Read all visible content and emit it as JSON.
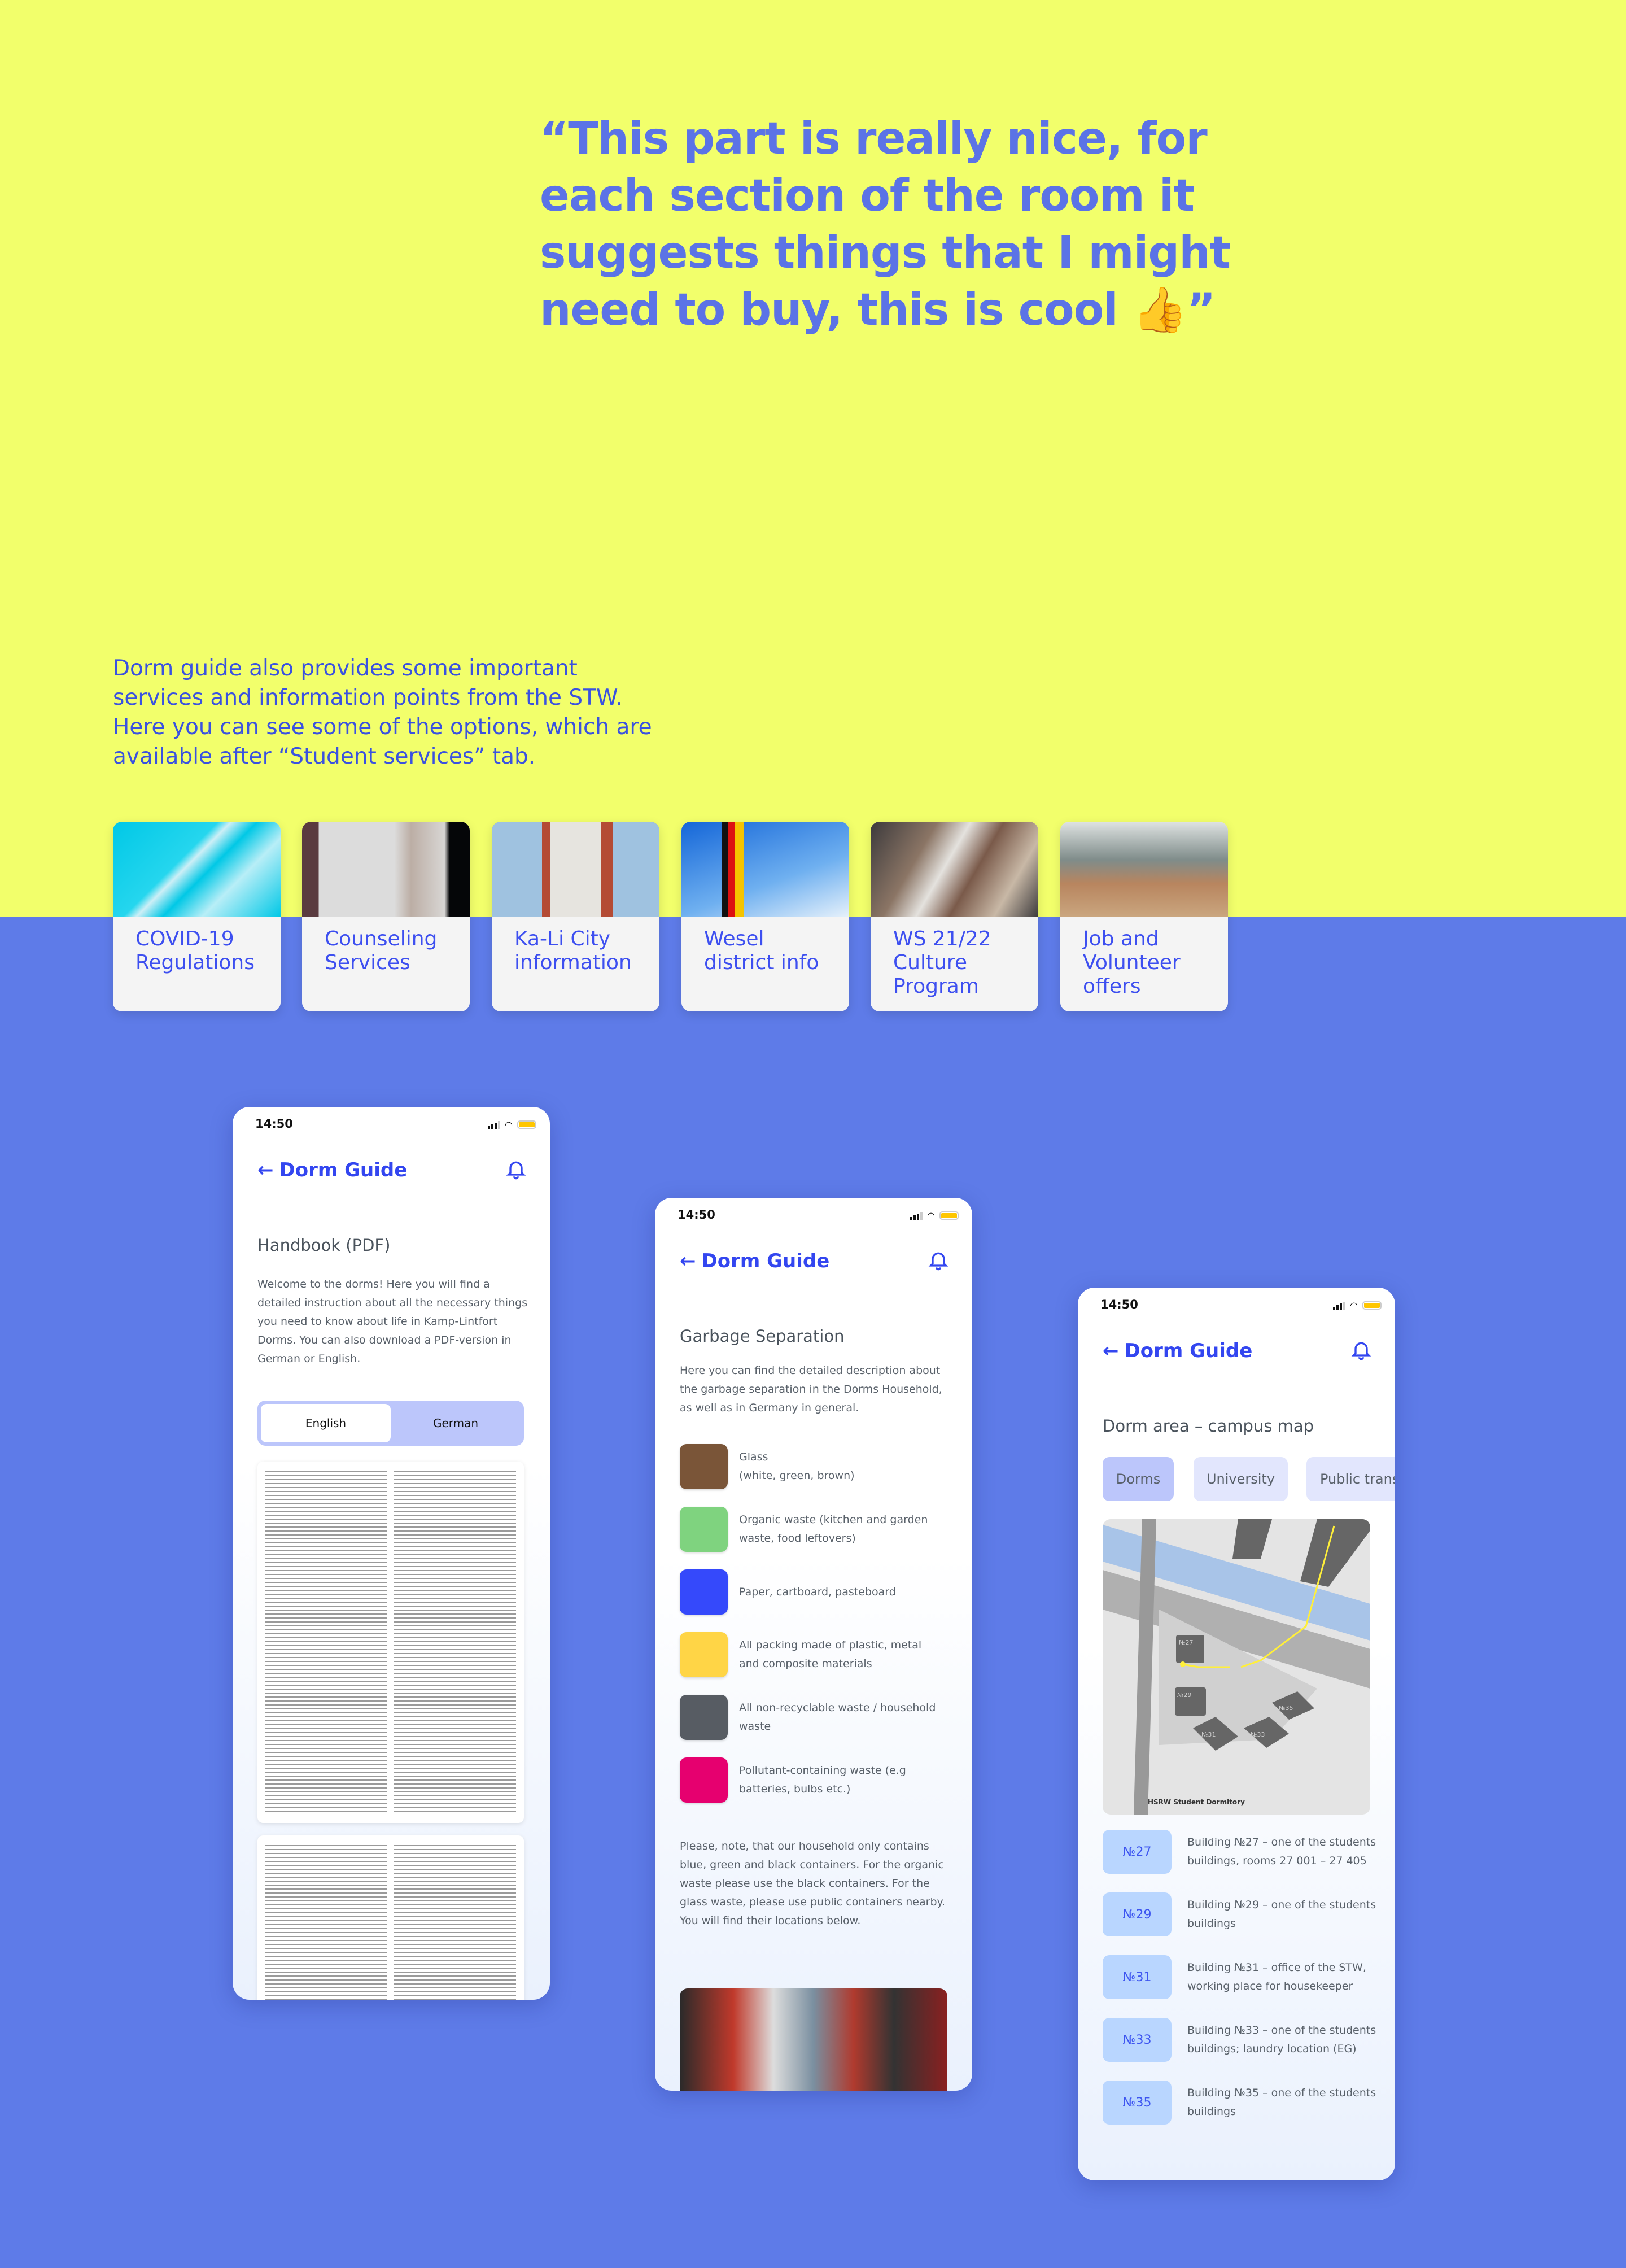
{
  "quote": "“This part is really nice, for each section of the room it suggests things that I might need to buy, this is cool 👍”",
  "intro": "Dorm guide also provides some important services and information points from the STW. Here you can see some of the options, which are available after “Student services” tab.",
  "colors": {
    "yellow_bg": "#f2ff6b",
    "blue_bg": "#5e7be8",
    "accent": "#3346f0"
  },
  "cards": [
    {
      "label": "COVID-19\nRegulations"
    },
    {
      "label": "Counseling\nServices"
    },
    {
      "label": "Ka-Li City\ninformation"
    },
    {
      "label": "Wesel\ndistrict info"
    },
    {
      "label": "WS 21/22\nCulture\nProgram"
    },
    {
      "label": "Job and\nVolunteer\noffers"
    }
  ],
  "phone_common": {
    "time": "14:50",
    "app_title": "Dorm Guide",
    "back_icon": "arrow-left-icon",
    "bell_icon": "bell-icon"
  },
  "handbook": {
    "title": "Handbook (PDF)",
    "text": "Welcome to the dorms! Here you will find a detailed instruction about all the necessary things you need to know about life in Kamp-Lintfort Dorms. You can also download a PDF-version in German or English.",
    "toggle": [
      "English",
      "German"
    ],
    "selected": "English"
  },
  "garbage": {
    "title": "Garbage Separation",
    "text": "Here you can find the detailed description about the garbage separation in the Dorms Household, as well as in Germany in general.",
    "items": [
      {
        "color": "#7a5538",
        "label": "Glass\n(white, green, brown)"
      },
      {
        "color": "#7fd37f",
        "label": "Organic waste (kitchen and garden waste, food leftovers)"
      },
      {
        "color": "#3549fb",
        "label": "Paper, cartboard, pasteboard"
      },
      {
        "color": "#ffd546",
        "label": "All packing made of plastic, metal and composite materials"
      },
      {
        "color": "#575c63",
        "label": "All non-recyclable waste / household waste"
      },
      {
        "color": "#e6006f",
        "label": "Pollutant-containing waste (e.g batteries, bulbs etc.)"
      }
    ],
    "note": "Please, note, that our household only contains blue, green and black containers. For the organic waste please use the black containers. For the glass waste, please use public containers nearby. You will find their locations below."
  },
  "map": {
    "title": "Dorm area – campus map",
    "tabs": [
      "Dorms",
      "University",
      "Public transport"
    ],
    "selected_tab": "Dorms",
    "caption": "HSRW Student Dormitory",
    "buildings": [
      {
        "badge": "№27",
        "text": "Building №27 – one of the students buildings, rooms 27 001 – 27 405"
      },
      {
        "badge": "№29",
        "text": "Building №29 – one of the students buildings"
      },
      {
        "badge": "№31",
        "text": "Building №31 – office of the STW, working place for housekeeper"
      },
      {
        "badge": "№33",
        "text": "Building №33 – one of the students buildings; laundry location (EG)"
      },
      {
        "badge": "№35",
        "text": "Building №35 – one of the students buildings"
      }
    ]
  }
}
